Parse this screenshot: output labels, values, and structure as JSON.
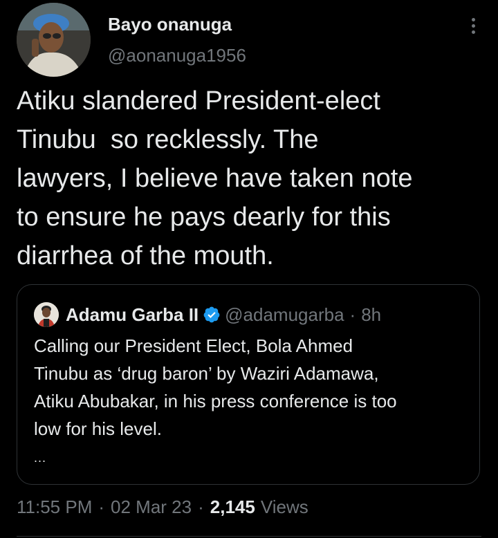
{
  "author": {
    "display_name": "Bayo onanuga",
    "handle": "@aonanuga1956",
    "avatar_icon": "user-avatar-photo"
  },
  "tweet": {
    "text": "Atiku slandered President-elect\nTinubu  so recklessly. The\nlawyers, I believe have taken note\nto ensure he pays dearly for this\ndiarrhea of the mouth."
  },
  "quote": {
    "display_name": "Adamu Garba II",
    "verified": true,
    "handle": "@adamugarba",
    "separator": "·",
    "time": "8h",
    "text": "Calling our President Elect, Bola Ahmed\nTinubu as ‘drug baron’ by Waziri Adamawa,\nAtiku Abubakar, in his press conference is too\nlow for his level.",
    "ellipsis": "..."
  },
  "meta": {
    "time": "11:55 PM",
    "sep1": "·",
    "date": "02 Mar 23",
    "sep2": "·",
    "views_count": "2,145",
    "views_label": "Views"
  },
  "colors": {
    "background": "#000000",
    "text_primary": "#e7e9ea",
    "text_secondary": "#71767b",
    "border": "#2f3336",
    "verified_badge": "#1d9bf0"
  }
}
